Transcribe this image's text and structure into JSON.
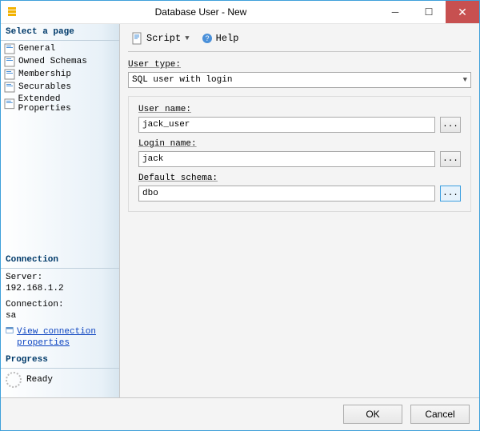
{
  "window": {
    "title": "Database User - New"
  },
  "sidebar": {
    "select_page": "Select a page",
    "items": [
      {
        "label": "General"
      },
      {
        "label": "Owned Schemas"
      },
      {
        "label": "Membership"
      },
      {
        "label": "Securables"
      },
      {
        "label": "Extended Properties"
      }
    ],
    "connection_header": "Connection",
    "server_label": "Server:",
    "server_value": "192.168.1.2",
    "connection_label": "Connection:",
    "connection_value": "sa",
    "view_props": "View connection properties",
    "progress_header": "Progress",
    "progress_status": "Ready"
  },
  "toolbar": {
    "script": "Script",
    "help": "Help"
  },
  "form": {
    "user_type_label": "User type:",
    "user_type_value": "SQL user with login",
    "user_name_label": "User name:",
    "user_name_value": "jack_user",
    "login_name_label": "Login name:",
    "login_name_value": "jack",
    "default_schema_label": "Default schema:",
    "default_schema_value": "dbo",
    "browse": "..."
  },
  "footer": {
    "ok": "OK",
    "cancel": "Cancel"
  }
}
